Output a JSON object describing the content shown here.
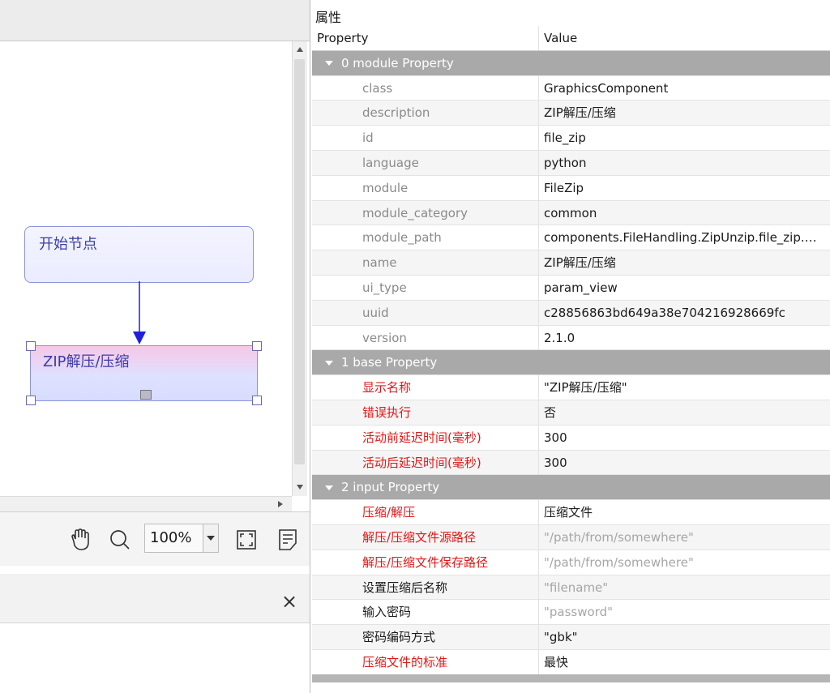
{
  "canvas": {
    "nodes": {
      "start_label": "开始节点",
      "zip_label": "ZIP解压/压缩"
    },
    "toolbar": {
      "zoom_value": "100%",
      "icons": [
        "hand-icon",
        "search-icon",
        "fit-screen-icon",
        "document-icon"
      ]
    },
    "lower_panel": {
      "close_glyph": "×"
    }
  },
  "properties_panel": {
    "title": "属性",
    "columns": {
      "property": "Property",
      "value": "Value"
    },
    "groups": [
      {
        "label": "0 module Property",
        "rows": [
          {
            "key": "class",
            "value": "GraphicsComponent"
          },
          {
            "key": "description",
            "value": "ZIP解压/压缩"
          },
          {
            "key": "id",
            "value": "file_zip"
          },
          {
            "key": "language",
            "value": "python"
          },
          {
            "key": "module",
            "value": "FileZip"
          },
          {
            "key": "module_category",
            "value": "common"
          },
          {
            "key": "module_path",
            "value": "components.FileHandling.ZipUnzip.file_zip.…"
          },
          {
            "key": "name",
            "value": "ZIP解压/压缩"
          },
          {
            "key": "ui_type",
            "value": "param_view"
          },
          {
            "key": "uuid",
            "value": "c28856863bd649a38e704216928669fc"
          },
          {
            "key": "version",
            "value": "2.1.0"
          }
        ]
      },
      {
        "label": "1 base Property",
        "rows": [
          {
            "key": "显示名称",
            "value": "\"ZIP解压/压缩\""
          },
          {
            "key": "错误执行",
            "value": "否"
          },
          {
            "key": "活动前延迟时间(毫秒)",
            "value": "300"
          },
          {
            "key": "活动后延迟时间(毫秒)",
            "value": "300"
          }
        ]
      },
      {
        "label": "2 input Property",
        "rows": [
          {
            "key": "压缩/解压",
            "value": "压缩文件"
          },
          {
            "key": "解压/压缩文件源路径",
            "value": "\"/path/from/somewhere\""
          },
          {
            "key": "解压/压缩文件保存路径",
            "value": "\"/path/from/somewhere\""
          },
          {
            "key": "设置压缩后名称",
            "value": "\"filename\""
          },
          {
            "key": "输入密码",
            "value": "\"password\""
          },
          {
            "key": "密码编码方式",
            "value": "\"gbk\""
          },
          {
            "key": "压缩文件的标准",
            "value": "最快"
          }
        ]
      }
    ]
  },
  "colors": {
    "group_header_bg": "#a9a9a9",
    "required_label": "#e01818",
    "attr_label": "#8a8a8a",
    "placeholder_value": "#a6a6a6",
    "node_border": "#8b92d8",
    "edge": "#1f1fe0"
  }
}
